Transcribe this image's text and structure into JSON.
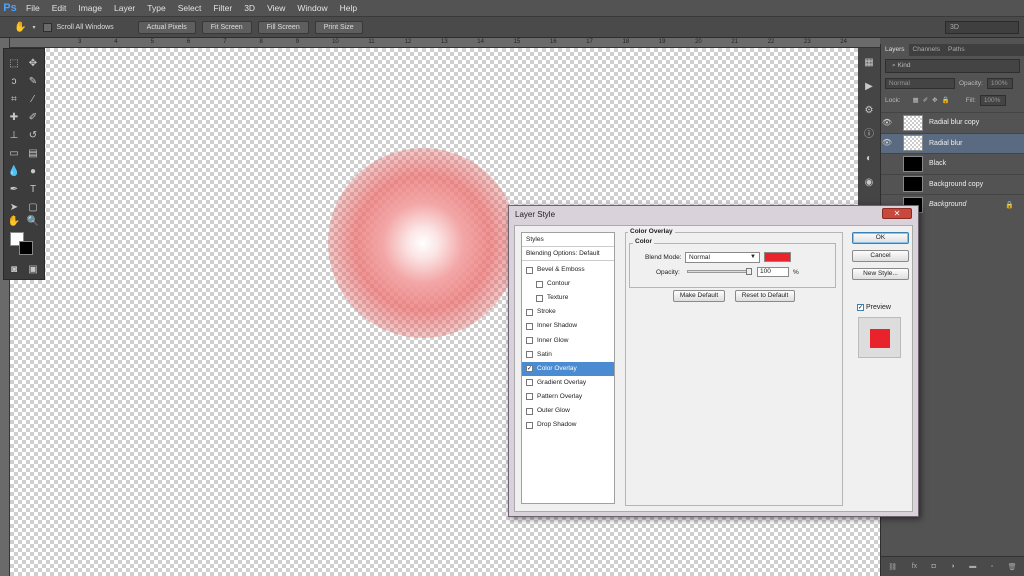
{
  "app": {
    "logo": "Ps"
  },
  "menu": [
    "File",
    "Edit",
    "Image",
    "Layer",
    "Type",
    "Select",
    "Filter",
    "3D",
    "View",
    "Window",
    "Help"
  ],
  "options_bar": {
    "scroll_all_label": "Scroll All Windows",
    "buttons": [
      "Actual Pixels",
      "Fit Screen",
      "Fill Screen",
      "Print Size"
    ],
    "workspace": "3D"
  },
  "ruler": {
    "ticks": [
      "3",
      "4",
      "5",
      "6",
      "7",
      "8",
      "9",
      "10",
      "11",
      "12",
      "13",
      "14",
      "15",
      "16",
      "17",
      "18",
      "19",
      "20",
      "21",
      "22",
      "23",
      "24"
    ]
  },
  "layers_panel": {
    "tabs": [
      "Layers",
      "Channels",
      "Paths"
    ],
    "kind_label": "Kind",
    "blend_mode": "Normal",
    "opacity_label": "Opacity:",
    "opacity_value": "100%",
    "lock_label": "Lock:",
    "fill_label": "Fill:",
    "fill_value": "100%",
    "layers": [
      {
        "name": "Radial blur copy",
        "visible": true,
        "thumb": "transparent",
        "selected": false
      },
      {
        "name": "Radial blur",
        "visible": true,
        "thumb": "transparent",
        "selected": true
      },
      {
        "name": "Black",
        "visible": false,
        "thumb": "black",
        "selected": false
      },
      {
        "name": "Background copy",
        "visible": false,
        "thumb": "black",
        "selected": false
      },
      {
        "name": "Background",
        "visible": false,
        "thumb": "black",
        "selected": false,
        "locked": true
      }
    ]
  },
  "dialog": {
    "title": "Layer Style",
    "close_glyph": "✕",
    "styles_header": "Styles",
    "blending_options": "Blending Options: Default",
    "styles": [
      {
        "label": "Bevel & Emboss",
        "checked": false,
        "sub": false
      },
      {
        "label": "Contour",
        "checked": false,
        "sub": true
      },
      {
        "label": "Texture",
        "checked": false,
        "sub": true
      },
      {
        "label": "Stroke",
        "checked": false,
        "sub": false
      },
      {
        "label": "Inner Shadow",
        "checked": false,
        "sub": false
      },
      {
        "label": "Inner Glow",
        "checked": false,
        "sub": false
      },
      {
        "label": "Satin",
        "checked": false,
        "sub": false
      },
      {
        "label": "Color Overlay",
        "checked": true,
        "sub": false,
        "selected": true
      },
      {
        "label": "Gradient Overlay",
        "checked": false,
        "sub": false
      },
      {
        "label": "Pattern Overlay",
        "checked": false,
        "sub": false
      },
      {
        "label": "Outer Glow",
        "checked": false,
        "sub": false
      },
      {
        "label": "Drop Shadow",
        "checked": false,
        "sub": false
      }
    ],
    "section_title": "Color Overlay",
    "group_title": "Color",
    "blend_mode_label": "Blend Mode:",
    "blend_mode_value": "Normal",
    "overlay_color": "#e8232b",
    "opacity_label": "Opacity:",
    "opacity_value": "100",
    "opacity_unit": "%",
    "make_default": "Make Default",
    "reset_default": "Reset to Default",
    "ok": "OK",
    "cancel": "Cancel",
    "new_style": "New Style...",
    "preview_label": "Preview",
    "preview_checked": true
  }
}
